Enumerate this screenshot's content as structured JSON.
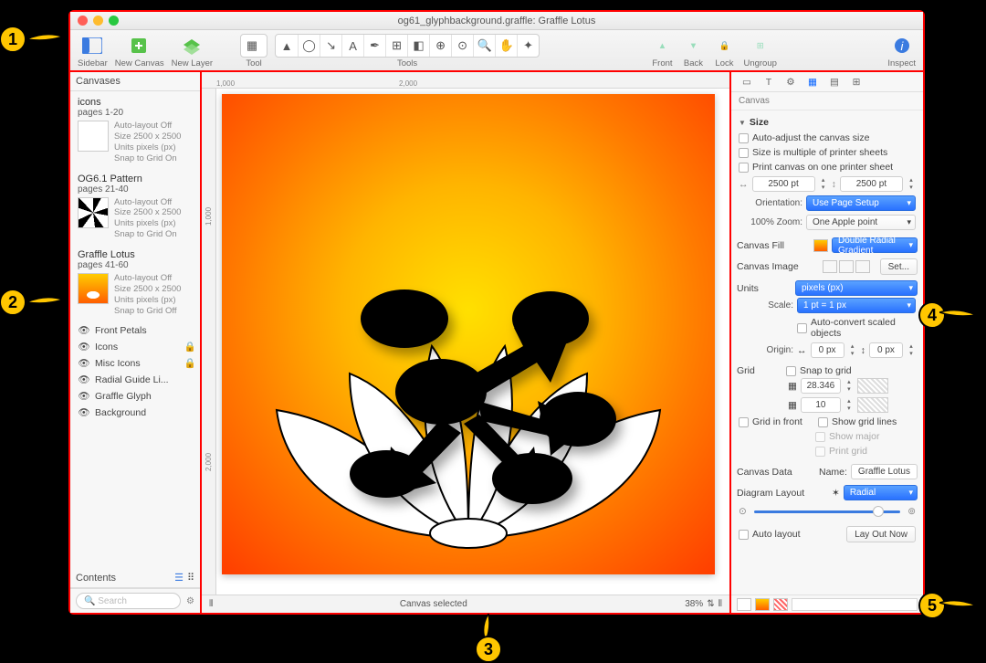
{
  "window": {
    "title": "og61_glyphbackground.graffle: Graffle Lotus"
  },
  "toolbar": {
    "sidebar": "Sidebar",
    "new_canvas": "New Canvas",
    "new_layer": "New Layer",
    "tool": "Tool",
    "tools": "Tools",
    "front": "Front",
    "back": "Back",
    "lock": "Lock",
    "ungroup": "Ungroup",
    "inspect": "Inspect"
  },
  "sidebar": {
    "header": "Canvases",
    "canvases": [
      {
        "title": "icons",
        "pages": "pages 1-20",
        "auto": "Auto-layout Off",
        "size": "Size 2500 x 2500",
        "units": "Units pixels (px)",
        "snap": "Snap to Grid On"
      },
      {
        "title": "OG6.1 Pattern",
        "pages": "pages 21-40",
        "auto": "Auto-layout Off",
        "size": "Size 2500 x 2500",
        "units": "Units pixels (px)",
        "snap": "Snap to Grid On"
      },
      {
        "title": "Graffle Lotus",
        "pages": "pages 41-60",
        "auto": "Auto-layout Off",
        "size": "Size 2500 x 2500",
        "units": "Units pixels (px)",
        "snap": "Snap to Grid Off"
      }
    ],
    "layers": [
      "Front Petals",
      "Icons",
      "Misc Icons",
      "Radial Guide Li...",
      "Graffle Glyph",
      "Background"
    ],
    "contents": "Contents",
    "search_placeholder": "Search"
  },
  "ruler": {
    "h1": "1,000",
    "h2": "2,000",
    "v1": "1,000",
    "v2": "2,000"
  },
  "status": {
    "text": "Canvas selected",
    "zoom": "38%"
  },
  "inspector": {
    "title": "Canvas",
    "size": {
      "label": "Size",
      "opt1": "Auto-adjust the canvas size",
      "opt2": "Size is multiple of printer sheets",
      "opt3": "Print canvas on one printer sheet",
      "w": "2500 pt",
      "h": "2500 pt",
      "orientation_label": "Orientation:",
      "orientation": "Use Page Setup",
      "zoom_label": "100% Zoom:",
      "zoom": "One Apple point"
    },
    "fill": {
      "label": "Canvas Fill",
      "value": "Double Radial Gradient"
    },
    "image": {
      "label": "Canvas Image",
      "set": "Set..."
    },
    "units": {
      "label": "Units",
      "value": "pixels (px)",
      "scale_label": "Scale:",
      "scale": "1 pt = 1 px",
      "auto_convert": "Auto-convert scaled objects",
      "origin_label": "Origin:",
      "ox": "0 px",
      "oy": "0 px"
    },
    "grid": {
      "label": "Grid",
      "snap": "Snap to grid",
      "spacing": "28.346",
      "subdiv": "10",
      "grid_front": "Grid in front",
      "show_lines": "Show grid lines",
      "show_major": "Show major",
      "print_grid": "Print grid"
    },
    "data": {
      "label": "Canvas Data",
      "name_label": "Name:",
      "name": "Graffle Lotus"
    },
    "diagram": {
      "label": "Diagram Layout",
      "value": "Radial",
      "auto_layout": "Auto layout",
      "layout_now": "Lay Out Now"
    }
  },
  "callouts": {
    "1": "1",
    "2": "2",
    "3": "3",
    "4": "4",
    "5": "5"
  }
}
